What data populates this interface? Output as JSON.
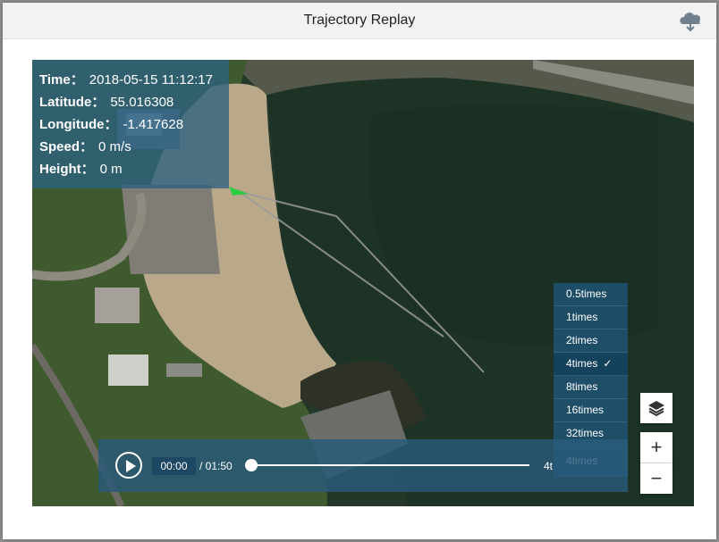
{
  "dialog": {
    "title": "Trajectory Replay",
    "download_icon": "cloud-download-icon"
  },
  "info": {
    "time_label": "Time：",
    "time_value": "2018-05-15 11:12:17",
    "latitude_label": "Latitude：",
    "latitude_value": "55.016308",
    "longitude_label": "Longitude：",
    "longitude_value": "-1.417628",
    "speed_label": "Speed：",
    "speed_value": "0 m/s",
    "height_label": "Height：",
    "height_value": "0 m"
  },
  "speed_menu": {
    "options": [
      "0.5times",
      "1times",
      "2times",
      "4times",
      "8times",
      "16times",
      "32times",
      "4times"
    ],
    "selected": "4times"
  },
  "player": {
    "play_icon": "play-icon",
    "current_time": "00:00",
    "total_time": "/ 01:50",
    "speed_label": "4t",
    "progress": 0
  },
  "controls": {
    "layers_icon": "layers-icon",
    "zoom_in_label": "+",
    "zoom_out_label": "−"
  },
  "colors": {
    "panel": "#2c6080",
    "marker": "#2ecc40",
    "track": "#9a9a9a"
  }
}
